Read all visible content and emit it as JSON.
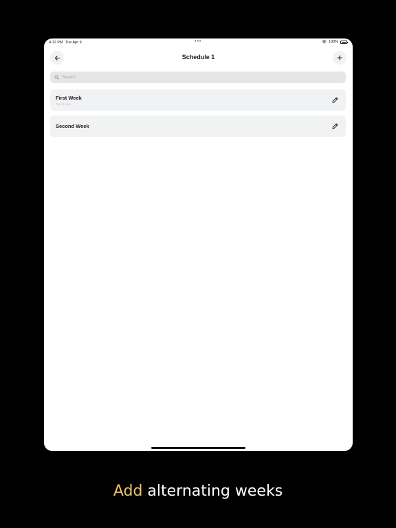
{
  "status_bar": {
    "time": "4:12 PM",
    "date": "Tue Apr 9",
    "battery": "100%"
  },
  "nav": {
    "title": "Schedule 1",
    "back_icon": "arrow-left-icon",
    "add_icon": "plus-icon"
  },
  "search": {
    "placeholder": "Search",
    "value": ""
  },
  "items": [
    {
      "title": "First Week",
      "subtitle": "Tap to view"
    },
    {
      "title": "Second Week",
      "subtitle": ""
    }
  ],
  "caption": {
    "accent": "Add",
    "rest": " alternating weeks"
  },
  "colors": {
    "accent": "#f2c469",
    "background": "#000000",
    "card": "#f1f2f3",
    "search_bg": "#e4e6e8"
  }
}
